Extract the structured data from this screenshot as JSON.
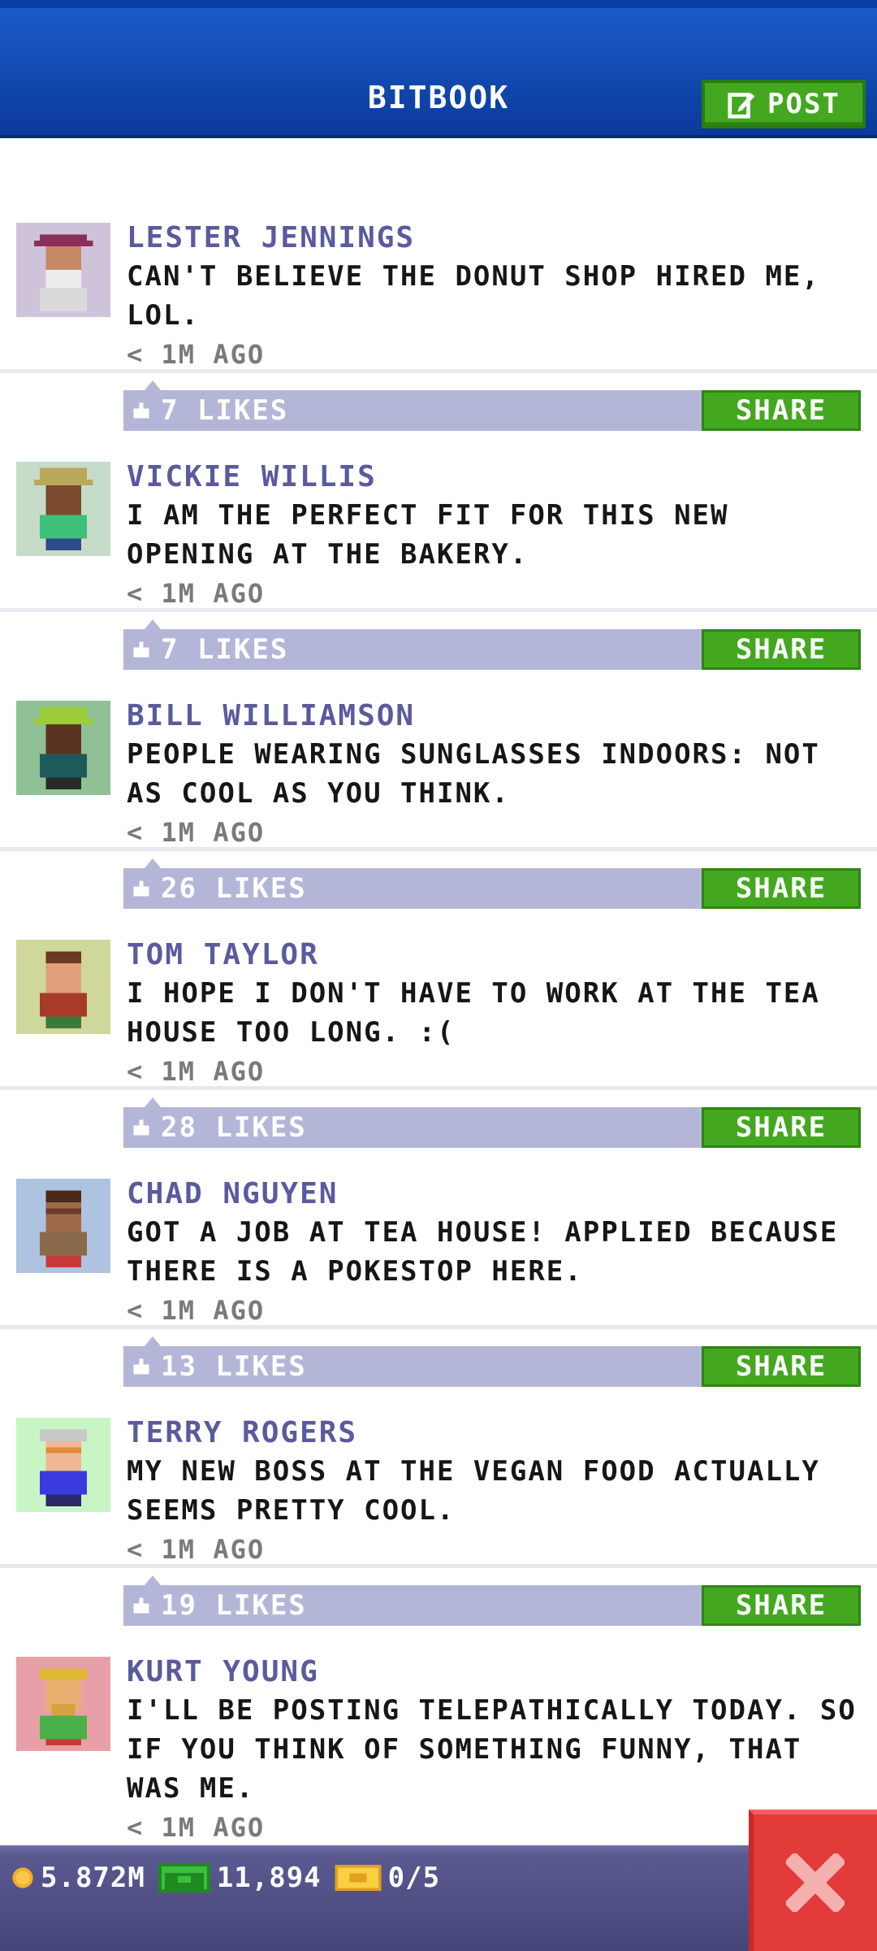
{
  "header": {
    "title": "BITBOOK",
    "post_label": "POST"
  },
  "feed": [
    {
      "name": "LESTER JENNINGS",
      "text": "CAN'T BELIEVE THE DONUT SHOP HIRED ME, LOL.",
      "time": "< 1M AGO",
      "likes": "7 LIKES",
      "share": "SHARE",
      "avatar_bg": "#cfc3d9"
    },
    {
      "name": "VICKIE WILLIS",
      "text": "I AM THE PERFECT FIT FOR THIS NEW OPENING AT THE BAKERY.",
      "time": "< 1M AGO",
      "likes": "7 LIKES",
      "share": "SHARE",
      "avatar_bg": "#c6dcc8"
    },
    {
      "name": "BILL WILLIAMSON",
      "text": "PEOPLE WEARING SUNGLASSES INDOORS: NOT AS COOL AS YOU THINK.",
      "time": "< 1M AGO",
      "likes": "26 LIKES",
      "share": "SHARE",
      "avatar_bg": "#8fc096"
    },
    {
      "name": "TOM TAYLOR",
      "text": "I HOPE I DON'T HAVE TO WORK AT THE TEA HOUSE TOO LONG. :(",
      "time": "< 1M AGO",
      "likes": "28 LIKES",
      "share": "SHARE",
      "avatar_bg": "#cfd79a"
    },
    {
      "name": "CHAD NGUYEN",
      "text": "GOT A JOB AT TEA HOUSE! APPLIED BECAUSE THERE IS A POKESTOP HERE.",
      "time": "< 1M AGO",
      "likes": "13 LIKES",
      "share": "SHARE",
      "avatar_bg": "#aec3e0"
    },
    {
      "name": "TERRY ROGERS",
      "text": "MY NEW BOSS AT THE VEGAN FOOD ACTUALLY SEEMS PRETTY COOL.",
      "time": "< 1M AGO",
      "likes": "19 LIKES",
      "share": "SHARE",
      "avatar_bg": "#c8f5c4"
    },
    {
      "name": "KURT YOUNG",
      "text": "I'LL BE POSTING TELEPATHICALLY TODAY. SO IF YOU THINK OF SOMETHING FUNNY, THAT WAS ME.",
      "time": "< 1M AGO",
      "avatar_bg": "#e8a0a8"
    }
  ],
  "bottombar": {
    "coins": "5.872M",
    "bux": "11,894",
    "tickets": "0/5"
  },
  "colors": {
    "header_blue": "#1b5cc9",
    "button_green": "#43a81f",
    "likebar_lavender": "#b4b6d8",
    "name_purple": "#5a5a9e",
    "close_red": "#e33a3a"
  }
}
